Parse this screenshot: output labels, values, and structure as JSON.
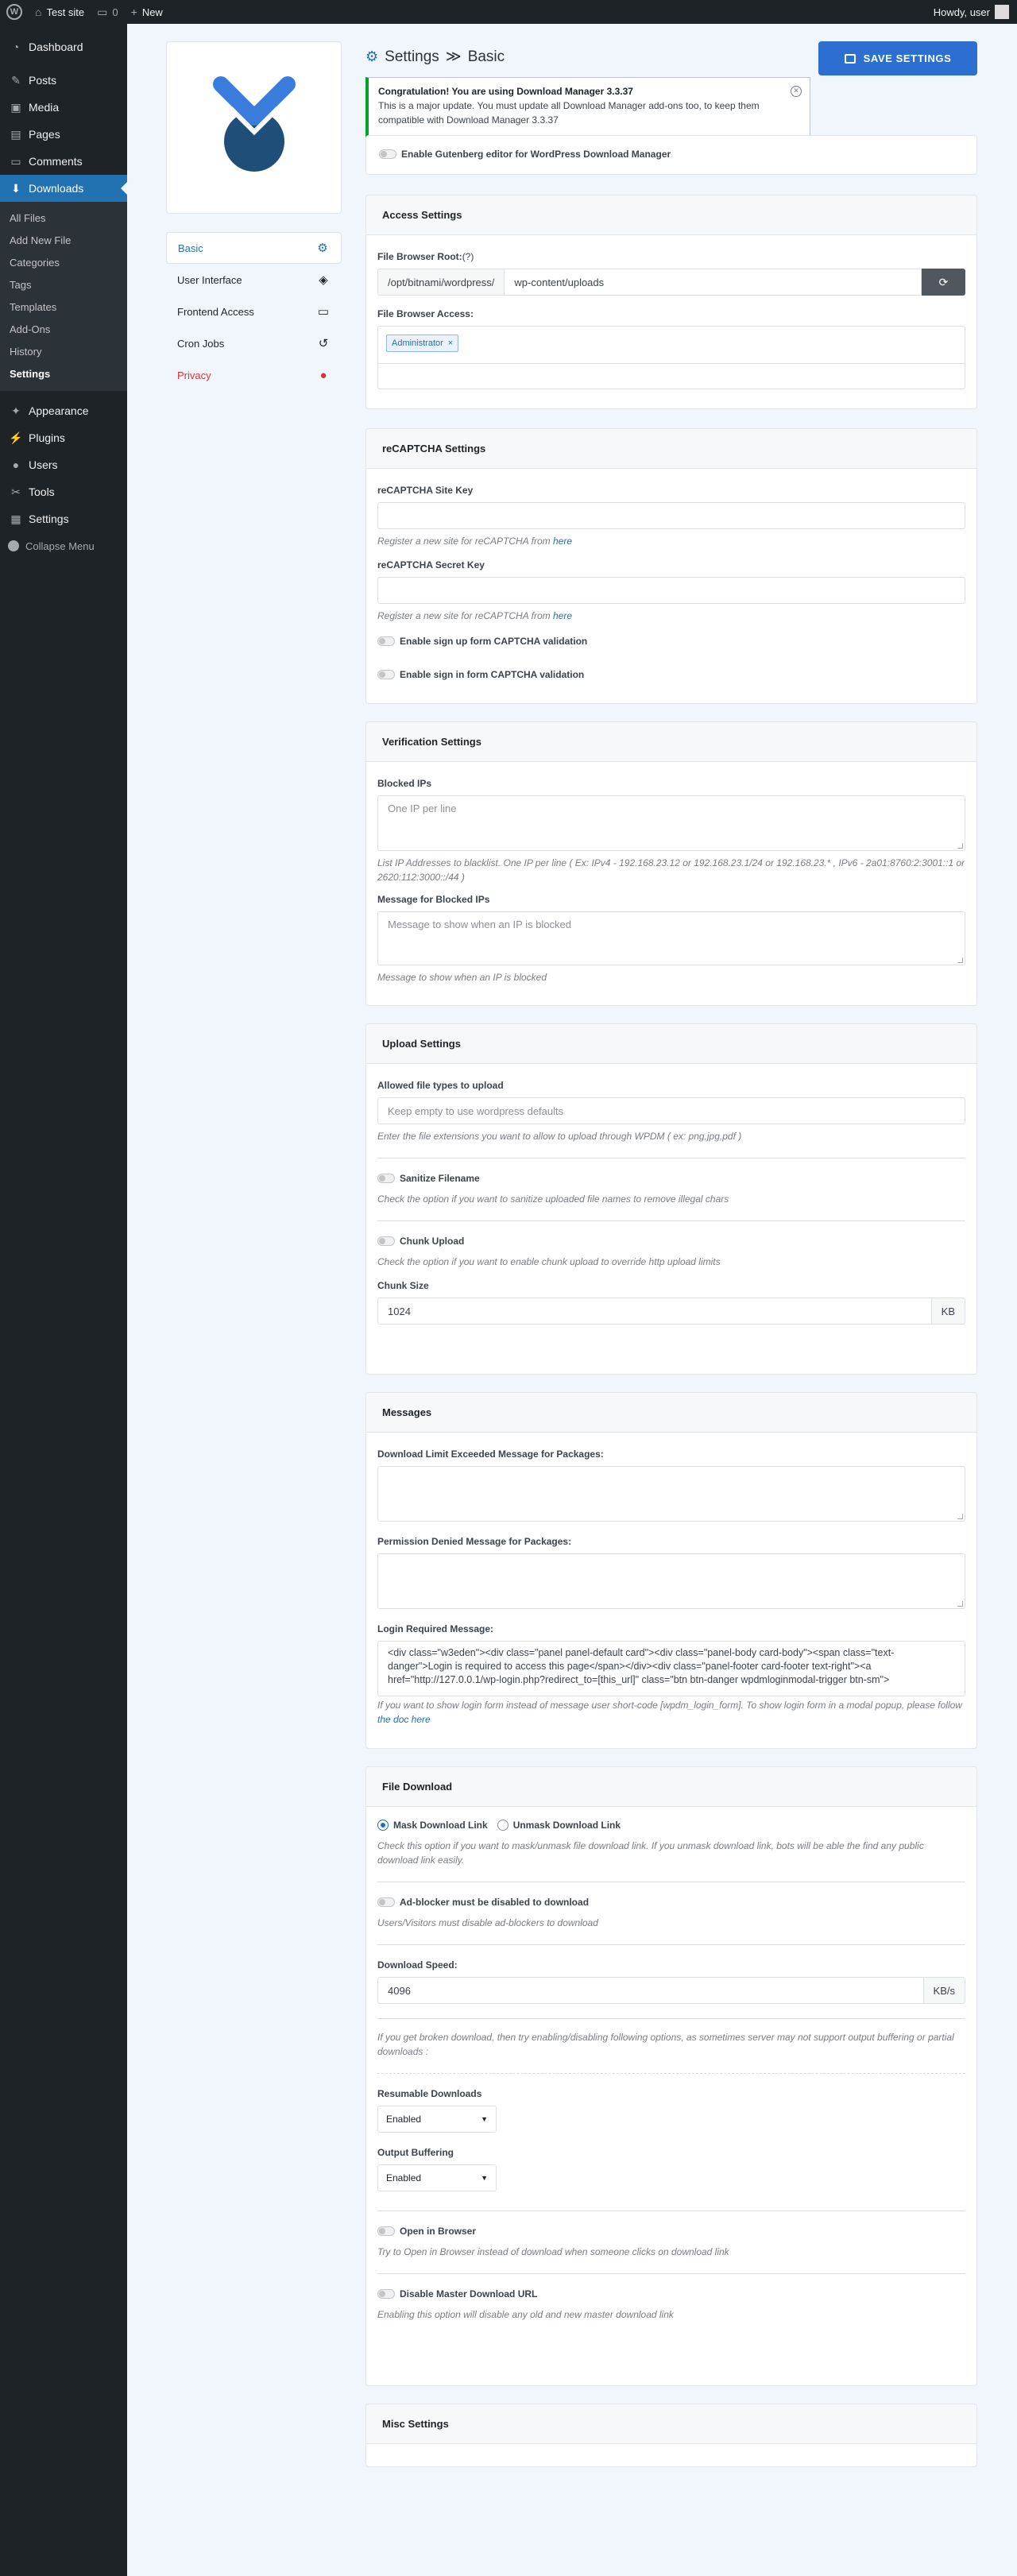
{
  "adminbar": {
    "site_name": "Test site",
    "comments_count": "0",
    "new_label": "New",
    "howdy": "Howdy, user"
  },
  "sidebar": {
    "menu_top": [
      {
        "label": "Dashboard",
        "icon": "dashboard-icon"
      },
      {
        "label": "Posts",
        "icon": "pin-icon"
      },
      {
        "label": "Media",
        "icon": "media-icon"
      },
      {
        "label": "Pages",
        "icon": "pages-icon"
      },
      {
        "label": "Comments",
        "icon": "comment-icon"
      },
      {
        "label": "Downloads",
        "icon": "download-icon"
      }
    ],
    "submenu": [
      "All Files",
      "Add New File",
      "Categories",
      "Tags",
      "Templates",
      "Add-Ons",
      "History",
      "Settings"
    ],
    "menu_bottom": [
      {
        "label": "Appearance",
        "icon": "brush-icon"
      },
      {
        "label": "Plugins",
        "icon": "plugin-icon"
      },
      {
        "label": "Users",
        "icon": "user-icon"
      },
      {
        "label": "Tools",
        "icon": "wrench-icon"
      },
      {
        "label": "Settings",
        "icon": "sliders-icon"
      }
    ],
    "collapse_label": "Collapse Menu"
  },
  "settings_nav": [
    {
      "label": "Basic",
      "icon": "gear-icon"
    },
    {
      "label": "User Interface",
      "icon": "paint-bucket-icon"
    },
    {
      "label": "Frontend Access",
      "icon": "monitor-icon"
    },
    {
      "label": "Cron Jobs",
      "icon": "history-icon"
    },
    {
      "label": "Privacy",
      "icon": "user-lock-icon"
    }
  ],
  "header": {
    "title": "Settings",
    "separator": "≫",
    "section": "Basic",
    "save_label": "SAVE SETTINGS"
  },
  "notice": {
    "title": "Congratulation! You are using Download Manager 3.3.37",
    "body": "This is a major update. You must update all Download Manager add-ons too, to keep them compatible with Download Manager 3.3.37"
  },
  "gutenberg": {
    "label": "Enable Gutenberg editor for WordPress Download Manager"
  },
  "access": {
    "title": "Access Settings",
    "root_label": "File Browser Root:",
    "root_help": "(?)",
    "root_prefix": "/opt/bitnami/wordpress/",
    "root_value": "wp-content/uploads",
    "access_label": "File Browser Access:",
    "access_tags": [
      "Administrator"
    ]
  },
  "recaptcha": {
    "title": "reCAPTCHA Settings",
    "site_key_label": "reCAPTCHA Site Key",
    "secret_key_label": "reCAPTCHA Secret Key",
    "register_text": "Register a new site for reCAPTCHA from",
    "register_link": "here",
    "signup_label": "Enable sign up form CAPTCHA validation",
    "signin_label": "Enable sign in form CAPTCHA validation"
  },
  "verification": {
    "title": "Verification Settings",
    "blocked_label": "Blocked IPs",
    "blocked_placeholder": "One IP per line",
    "blocked_help": "List IP Addresses to blacklist. One IP per line ( Ex: IPv4 - 192.168.23.12 or 192.168.23.1/24 or 192.168.23.* , IPv6 - 2a01:8760:2:3001::1 or 2620:112:3000::/44 )",
    "message_label": "Message for Blocked IPs",
    "message_placeholder": "Message to show when an IP is blocked",
    "message_help": "Message to show when an IP is blocked"
  },
  "upload": {
    "title": "Upload Settings",
    "types_label": "Allowed file types to upload",
    "types_placeholder": "Keep empty to use wordpress defaults",
    "types_help": "Enter the file extensions you want to allow to upload through WPDM ( ex: png,jpg,pdf )",
    "sanitize_label": "Sanitize Filename",
    "sanitize_help": "Check the option if you want to sanitize uploaded file names to remove illegal chars",
    "chunk_label": "Chunk Upload",
    "chunk_help": "Check the option if you want to enable chunk upload to override http upload limits",
    "chunk_size_label": "Chunk Size",
    "chunk_size_value": "1024",
    "chunk_size_unit": "KB"
  },
  "messages": {
    "title": "Messages",
    "limit_label": "Download Limit Exceeded Message for Packages:",
    "denied_label": "Permission Denied Message for Packages:",
    "login_label": "Login Required Message:",
    "login_value": "<div class=\"w3eden\"><div class=\"panel panel-default card\"><div class=\"panel-body card-body\"><span class=\"text-danger\">Login is required to access this page</span></div><div class=\"panel-footer card-footer text-right\"><a href=\"http://127.0.0.1/wp-login.php?redirect_to=[this_url]\" class=\"btn btn-danger wpdmloginmodal-trigger btn-sm\">",
    "login_help": "If you want to show login form instead of message user short-code [wpdm_login_form]. To show login form in a modal popup, please follow",
    "login_link": "the doc here"
  },
  "file_download": {
    "title": "File Download",
    "mask_label": "Mask Download Link",
    "unmask_label": "Unmask Download Link",
    "mask_help": "Check this option if you want to mask/unmask file download link. If you unmask download link, bots will be able the find any public download link easily.",
    "adblock_label": "Ad-blocker must be disabled to download",
    "adblock_help": "Users/Visitors must disable ad-blockers to download",
    "speed_label": "Download Speed:",
    "speed_value": "4096",
    "speed_unit": "KB/s",
    "broken_help": "If you get broken download, then try enabling/disabling following options, as sometimes server may not support output buffering or partial downloads :",
    "resumable_label": "Resumable Downloads",
    "resumable_value": "Enabled",
    "buffering_label": "Output Buffering",
    "buffering_value": "Enabled",
    "browser_label": "Open in Browser",
    "browser_help": "Try to Open in Browser instead of download when someone clicks on download link",
    "master_label": "Disable Master Download URL",
    "master_help": "Enabling this option will disable any old and new master download link"
  },
  "misc": {
    "title": "Misc Settings"
  },
  "colors": {
    "accent": "#2271b1",
    "save_button": "#2c6fd1",
    "sidebar": "#1d2327",
    "notice_border": "#00a32a",
    "privacy": "#d63638"
  }
}
